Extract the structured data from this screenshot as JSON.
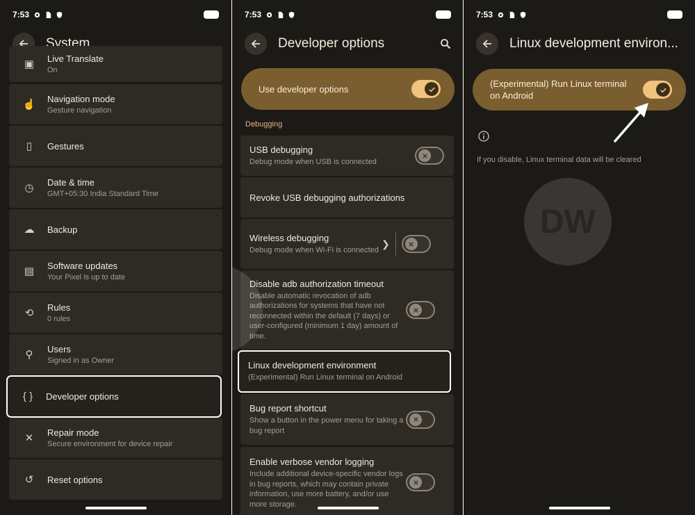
{
  "status": {
    "time": "7:53"
  },
  "system": {
    "title": "System",
    "partial_item": {
      "label": "Live Translate",
      "sub": "On"
    },
    "items": [
      {
        "label": "Navigation mode",
        "sub": "Gesture navigation",
        "icon": "gesture-hand-icon"
      },
      {
        "label": "Gestures",
        "sub": "",
        "icon": "phone-gesture-icon"
      },
      {
        "label": "Date & time",
        "sub": "GMT+05:30 India Standard Time",
        "icon": "clock-icon"
      },
      {
        "label": "Backup",
        "sub": "",
        "icon": "cloud-upload-icon"
      },
      {
        "label": "Software updates",
        "sub": "Your Pixel is up to date",
        "icon": "system-update-icon"
      },
      {
        "label": "Rules",
        "sub": "0 rules",
        "icon": "rules-icon"
      },
      {
        "label": "Users",
        "sub": "Signed in as Owner",
        "icon": "person-icon"
      },
      {
        "label": "Developer options",
        "sub": "",
        "icon": "braces-icon"
      },
      {
        "label": "Repair mode",
        "sub": "Secure environment for device repair",
        "icon": "tools-icon"
      },
      {
        "label": "Reset options",
        "sub": "",
        "icon": "history-icon"
      }
    ]
  },
  "developer": {
    "title": "Developer options",
    "master_label": "Use developer options",
    "master_on": true,
    "section": "Debugging",
    "items": [
      {
        "label": "USB debugging",
        "sub": "Debug mode when USB is connected",
        "toggle": "off"
      },
      {
        "label": "Revoke USB debugging authorizations",
        "sub": "",
        "toggle": "none"
      },
      {
        "label": "Wireless debugging",
        "sub": "Debug mode when Wi-Fi is connected",
        "toggle": "off"
      },
      {
        "label": "Disable adb authorization timeout",
        "sub": "Disable automatic revocation of adb authorizations for systems that have not reconnected within the default (7 days) or user-configured (minimum 1 day) amount of time.",
        "toggle": "off"
      },
      {
        "label": "Linux development environment",
        "sub": "(Experimental) Run Linux terminal on Android",
        "toggle": "none"
      },
      {
        "label": "Bug report shortcut",
        "sub": "Show a button in the power menu for taking a bug report",
        "toggle": "off"
      },
      {
        "label": "Enable verbose vendor logging",
        "sub": "Include additional device-specific vendor logs in bug reports, which may contain private information, use more battery, and/or use more storage.",
        "toggle": "off"
      }
    ]
  },
  "linux": {
    "title": "Linux development environ...",
    "master_label": "(Experimental) Run Linux terminal on Android",
    "master_on": true,
    "info": "If you disable, Linux terminal data will be cleared"
  },
  "watermark": "DW",
  "colors": {
    "background": "#1c1a16",
    "card": "#2e2a24",
    "master_card": "#7b5e2f",
    "toggle_on": "#f0c37e",
    "section_header": "#e3b878",
    "highlight": "#ffffff"
  }
}
